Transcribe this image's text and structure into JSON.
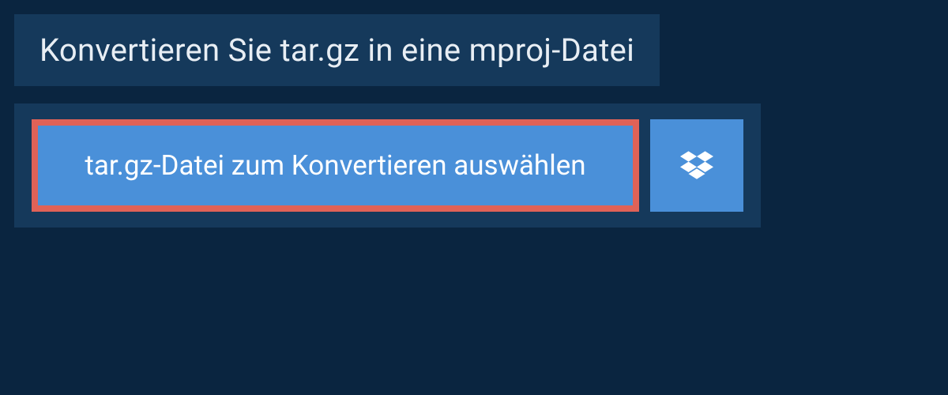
{
  "header": {
    "title": "Konvertieren Sie tar.gz in eine mproj-Datei"
  },
  "upload": {
    "select_label": "tar.gz-Datei zum Konvertieren auswählen",
    "dropbox_icon": "dropbox"
  },
  "colors": {
    "page_bg": "#0a2540",
    "panel_bg": "#15395b",
    "button_bg": "#4a90d9",
    "highlight_border": "#e06257",
    "text_light": "#e8eef4",
    "text_white": "#ffffff"
  }
}
